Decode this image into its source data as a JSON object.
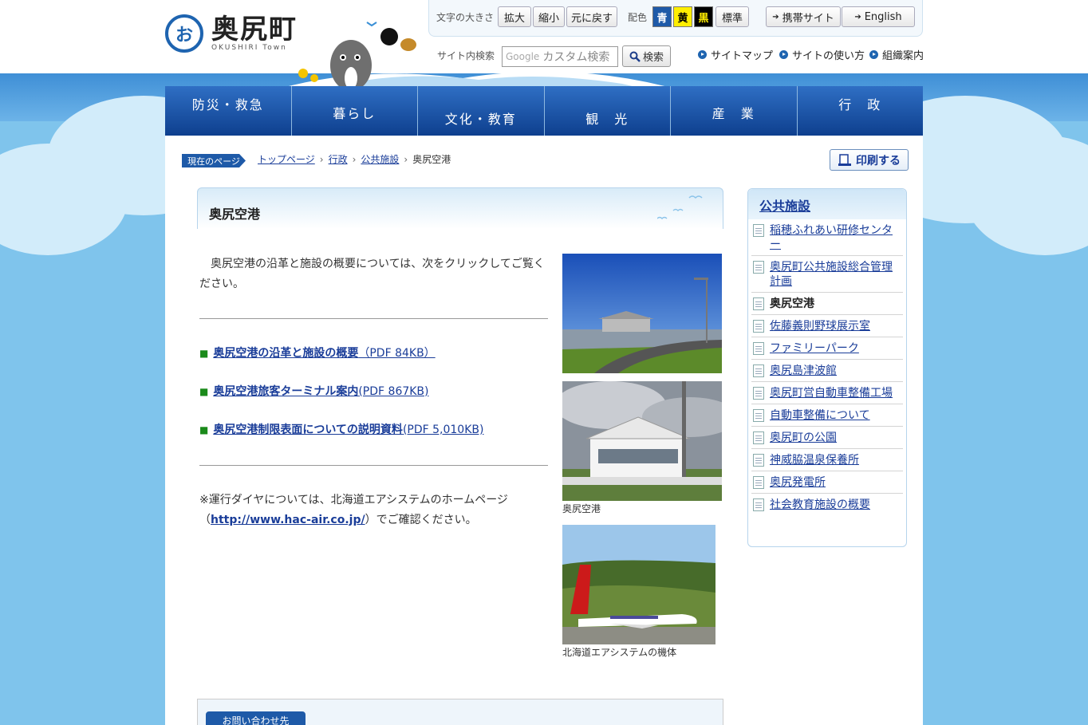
{
  "header": {
    "logo_title": "奥尻町",
    "logo_sub": "OKUSHIRI Town",
    "font_size_label": "文字の大きさ",
    "font_buttons": [
      "拡大",
      "縮小",
      "元に戻す"
    ],
    "color_label": "配色",
    "color_buttons": [
      {
        "label": "青",
        "bg": "#1e5aa8",
        "fg": "#ffffff"
      },
      {
        "label": "黄",
        "bg": "#ffee00",
        "fg": "#000000"
      },
      {
        "label": "黒",
        "bg": "#000000",
        "fg": "#ffee00"
      },
      {
        "label": "標準",
        "bg": "#f4f4f4",
        "fg": "#222222"
      }
    ],
    "mobile_site": "携帯サイト",
    "english": "English",
    "search_label": "サイト内検索",
    "search_placeholder_brand": "Google",
    "search_placeholder": "カスタム検索",
    "search_button": "検索",
    "links": [
      "サイトマップ",
      "サイトの使い方",
      "組織案内"
    ]
  },
  "nav": [
    "防災・救急",
    "暮らし",
    "文化・教育",
    "観　光",
    "産　業",
    "行　政"
  ],
  "breadcrumb": {
    "tag": "現在のページ",
    "items": [
      "トップページ",
      "行政",
      "公共施設"
    ],
    "current": "奥尻空港"
  },
  "print_button": "印刷する",
  "page": {
    "title": "奥尻空港",
    "intro": "　奥尻空港の沿革と施設の概要については、次をクリックしてご覧ください。",
    "documents": [
      {
        "label": "奥尻空港の沿革と施設の概要",
        "meta": "（PDF 84KB）"
      },
      {
        "label": "奥尻空港旅客ターミナル案内",
        "meta": "(PDF 867KB)"
      },
      {
        "label": "奥尻空港制限表面についての説明資料",
        "meta": "(PDF 5,010KB)"
      }
    ],
    "note_prefix": "※運行ダイヤについては、北海道エアシステムのホームページ（",
    "note_link": "http://www.hac-air.co.jp/",
    "note_suffix": "）でご確認ください。",
    "photo_captions": [
      "奥尻空港",
      "北海道エアシステムの機体"
    ],
    "contact_tab": "お問い合わせ先"
  },
  "sidebar": {
    "title": "公共施設",
    "items": [
      {
        "label": "稲穂ふれあい研修センター",
        "current": false
      },
      {
        "label": "奥尻町公共施設総合管理計画",
        "current": false
      },
      {
        "label": "奥尻空港",
        "current": true
      },
      {
        "label": "佐藤義則野球展示室",
        "current": false
      },
      {
        "label": "ファミリーパーク",
        "current": false
      },
      {
        "label": "奥尻島津波館",
        "current": false
      },
      {
        "label": "奥尻町営自動車整備工場",
        "current": false
      },
      {
        "label": "自動車整備について",
        "current": false
      },
      {
        "label": "奥尻町の公園",
        "current": false
      },
      {
        "label": "神威脇温泉保養所",
        "current": false
      },
      {
        "label": "奥尻発電所",
        "current": false
      },
      {
        "label": "社会教育施設の概要",
        "current": false
      }
    ]
  }
}
